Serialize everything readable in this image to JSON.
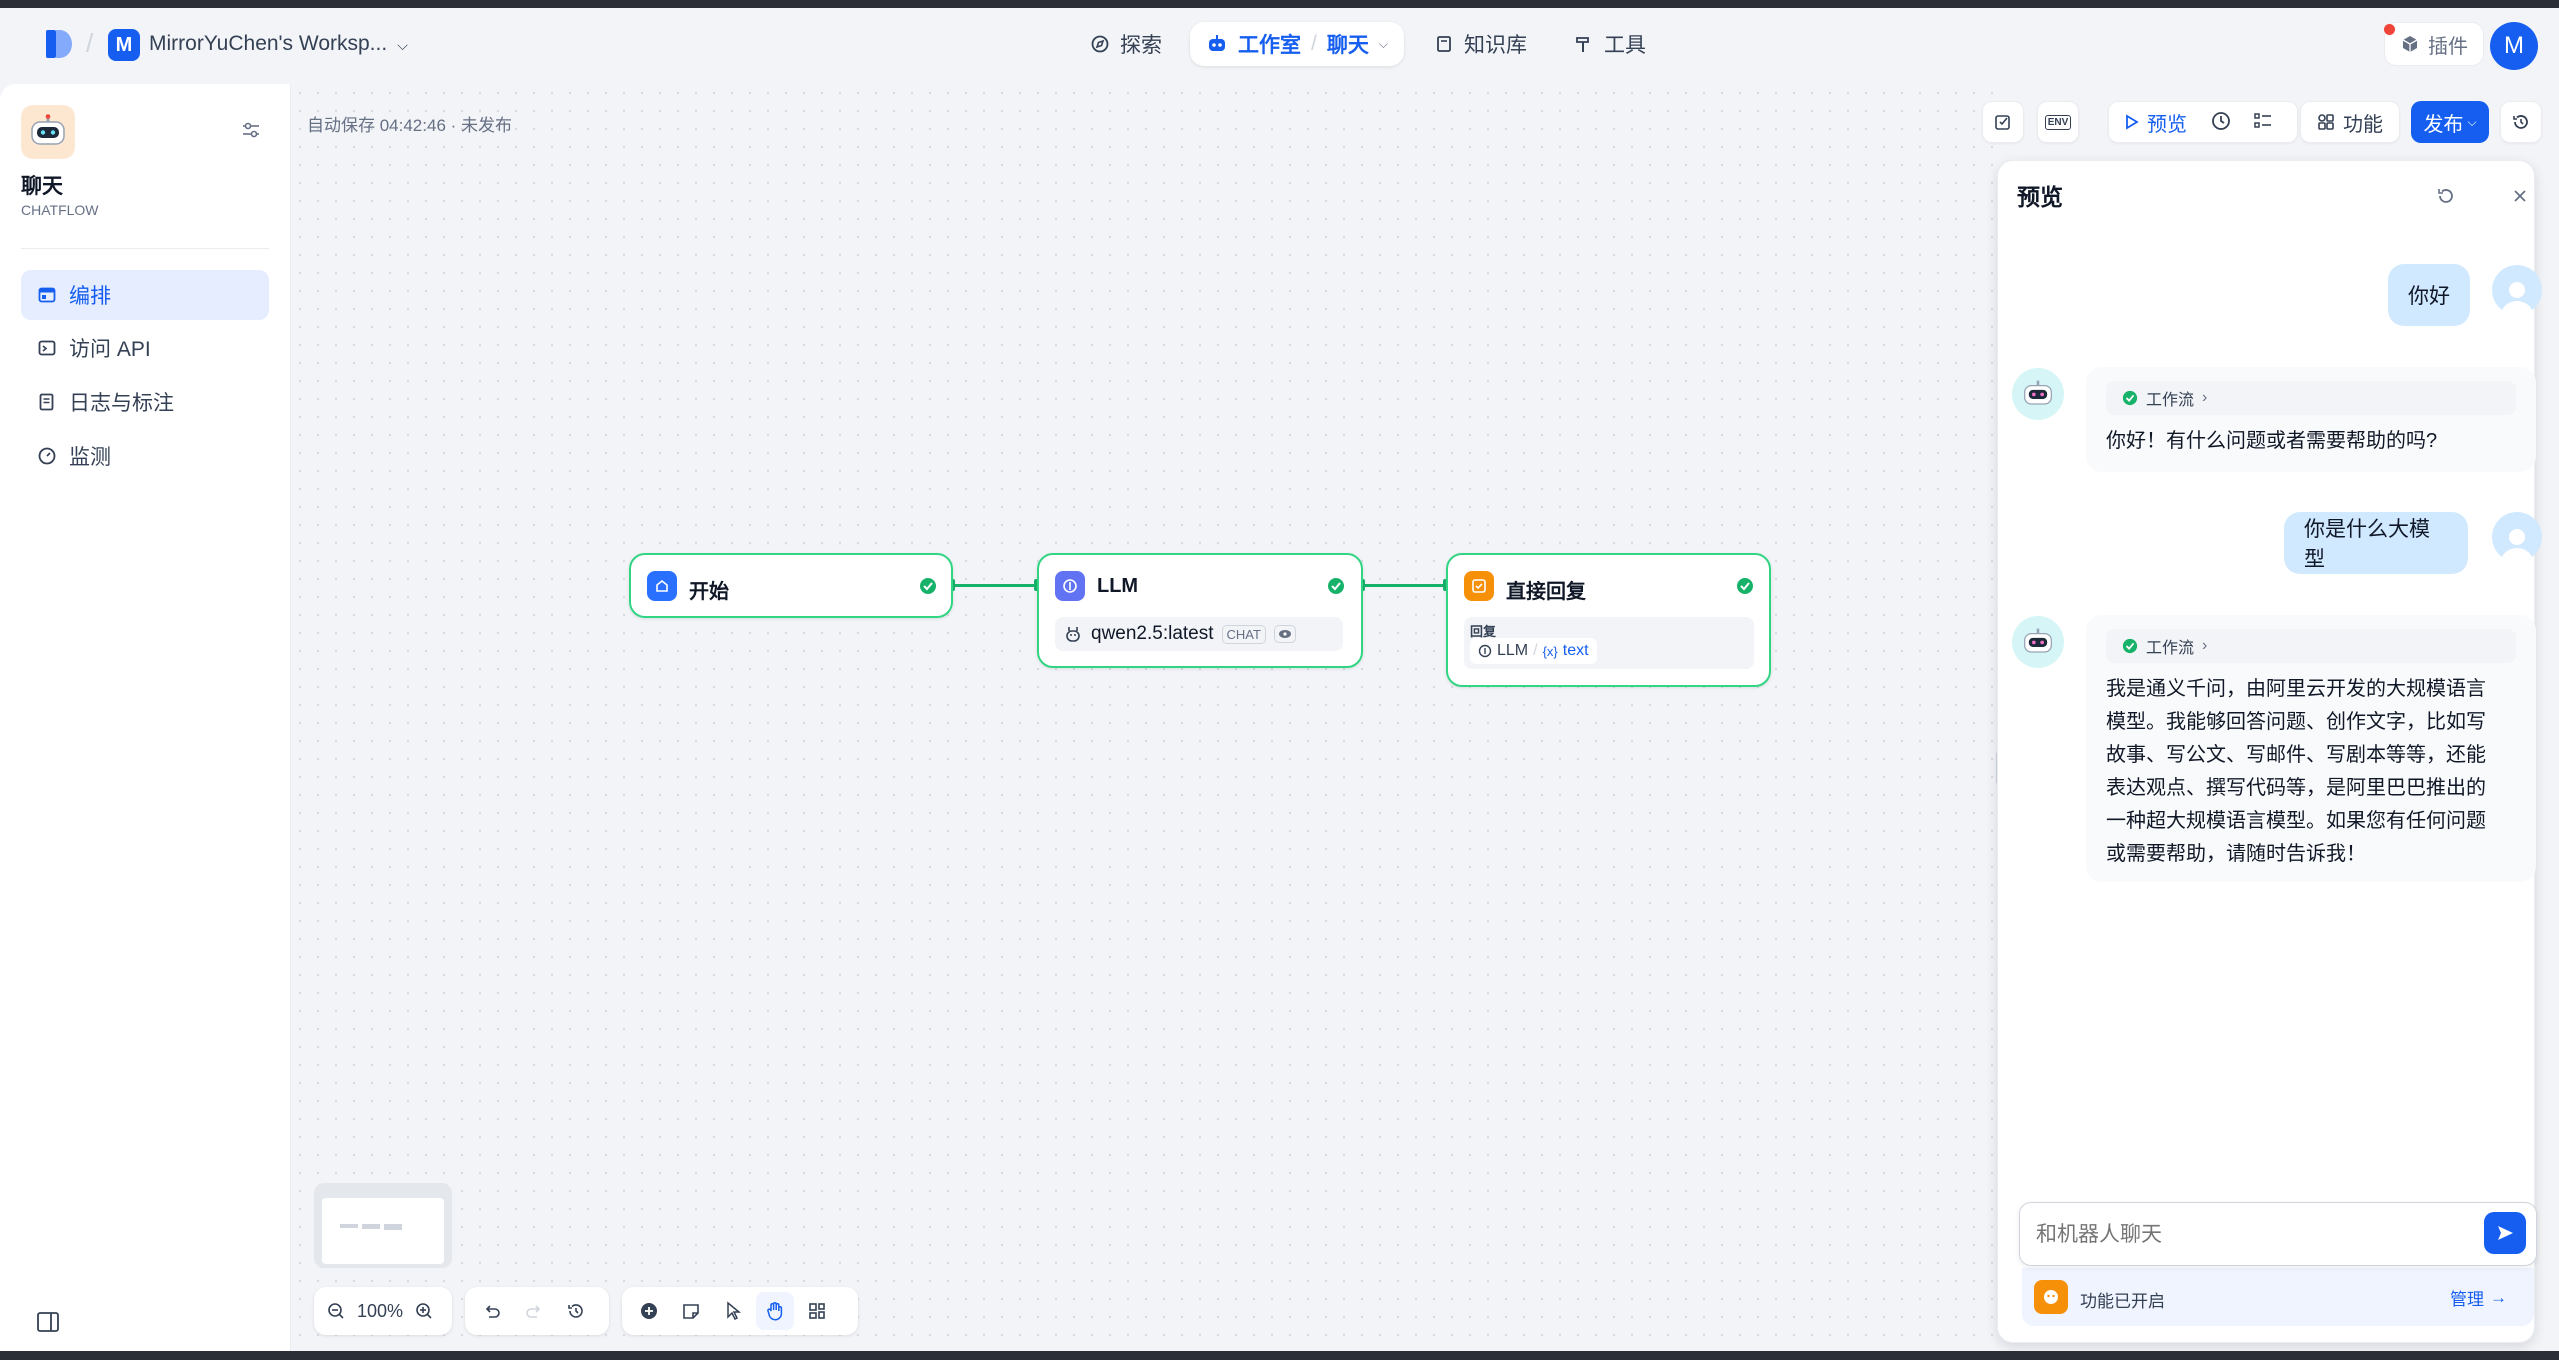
{
  "topbar": {
    "workspace_initial": "M",
    "workspace_name": "MirrorYuChen's Worksp...",
    "nav": {
      "explore": "探索",
      "studio": "工作室",
      "app": "聊天",
      "knowledge": "知识库",
      "tools": "工具"
    },
    "plugins": "插件",
    "user_initial": "M"
  },
  "sidebar": {
    "app_name": "聊天",
    "app_type": "CHATFLOW",
    "items": [
      {
        "label": "编排",
        "icon": "layout-icon"
      },
      {
        "label": "访问 API",
        "icon": "terminal-icon"
      },
      {
        "label": "日志与标注",
        "icon": "file-list-icon"
      },
      {
        "label": "监测",
        "icon": "dashboard-icon"
      }
    ]
  },
  "canvas": {
    "autosave": "自动保存 04:42:46 · 未发布",
    "toolbar": {
      "env": "ENV",
      "preview": "预览",
      "features": "功能",
      "publish": "发布"
    },
    "nodes": {
      "start": {
        "title": "开始"
      },
      "llm": {
        "title": "LLM",
        "model": "qwen2.5:latest",
        "mode_badge": "CHAT"
      },
      "answer": {
        "title": "直接回复",
        "field_label": "回复",
        "var_node": "LLM",
        "var_sep": "/",
        "var_name": "text",
        "var_prefix": "{x}"
      }
    },
    "zoom": "100%"
  },
  "preview": {
    "title": "预览",
    "messages": [
      {
        "role": "user",
        "text": "你好"
      },
      {
        "role": "bot",
        "workflow_label": "工作流",
        "text": "你好！有什么问题或者需要帮助的吗?"
      },
      {
        "role": "user",
        "text": "你是什么大模型"
      },
      {
        "role": "bot",
        "workflow_label": "工作流",
        "lines": [
          "我是通义千问，由阿里云开发的大规模语言",
          "模型。我能够回答问题、创作文字，比如写",
          "故事、写公文、写邮件、写剧本等等，还能",
          "表达观点、撰写代码等，是阿里巴巴推出的",
          "一种超大规模语言模型。如果您有任何问题",
          "或需要帮助，请随时告诉我！"
        ]
      }
    ],
    "input_placeholder": "和机器人聊天",
    "features_enabled": "功能已开启",
    "manage": "管理"
  },
  "colors": {
    "primary": "#155eef",
    "success": "#17b26a",
    "node_border": "#32d583"
  }
}
